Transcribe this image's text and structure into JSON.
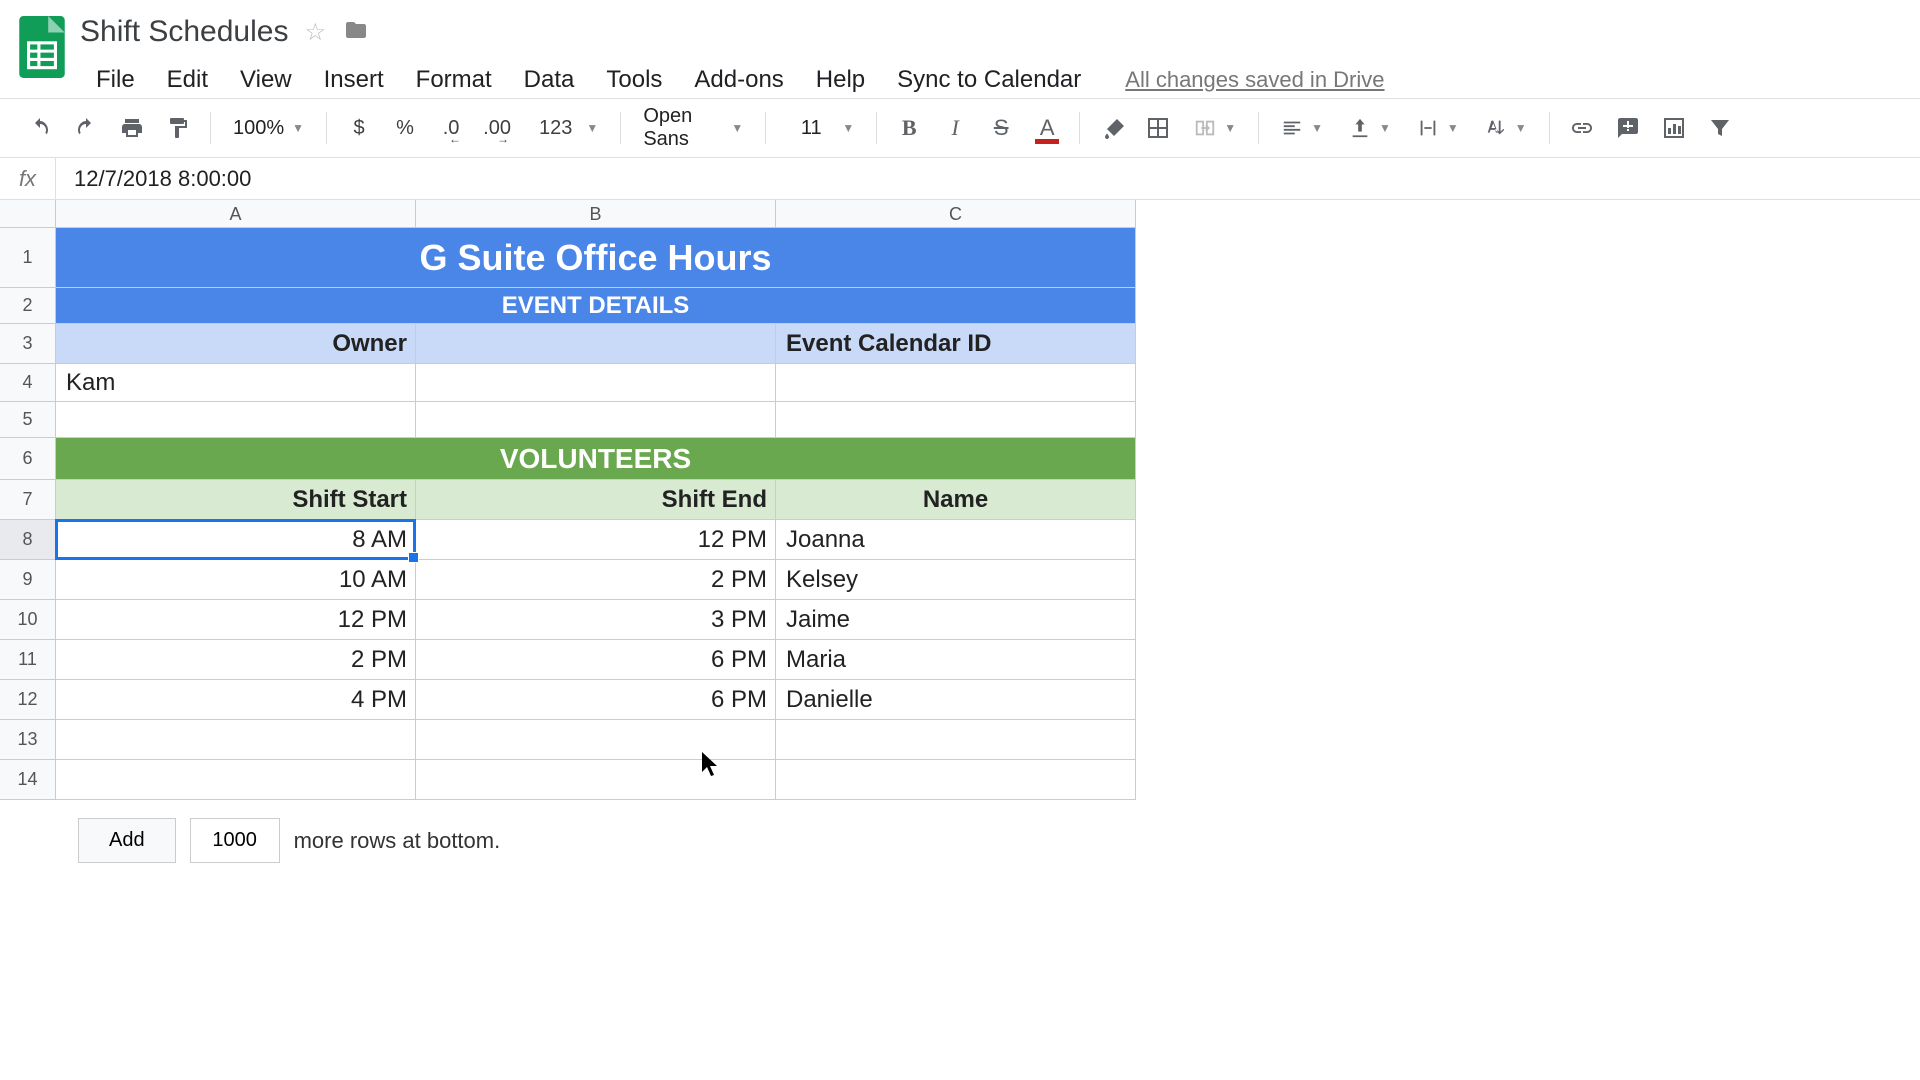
{
  "doc": {
    "title": "Shift Schedules"
  },
  "menu": {
    "file": "File",
    "edit": "Edit",
    "view": "View",
    "insert": "Insert",
    "format": "Format",
    "data": "Data",
    "tools": "Tools",
    "addons": "Add-ons",
    "help": "Help",
    "sync": "Sync to Calendar",
    "save_status": "All changes saved in Drive"
  },
  "toolbar": {
    "zoom": "100%",
    "currency": "$",
    "percent": "%",
    "dec_dec": ".0",
    "dec_inc": ".00",
    "format_num": "123",
    "font": "Open Sans",
    "font_size": "11",
    "bold": "B",
    "italic": "I",
    "strike": "S",
    "textcolor": "A"
  },
  "formula": {
    "label": "fx",
    "value": "12/7/2018 8:00:00"
  },
  "columns": {
    "A": "A",
    "B": "B",
    "C": "C"
  },
  "rows": [
    "1",
    "2",
    "3",
    "4",
    "5",
    "6",
    "7",
    "8",
    "9",
    "10",
    "11",
    "12",
    "13",
    "14"
  ],
  "sheet": {
    "title": "G Suite Office Hours",
    "subtitle": "EVENT DETAILS",
    "owner_label": "Owner",
    "calendar_label": "Event Calendar ID",
    "owner_value": "Kam",
    "vol_header": "VOLUNTEERS",
    "col_start": "Shift Start",
    "col_end": "Shift End",
    "col_name": "Name",
    "data": [
      {
        "start": "8 AM",
        "end": "12 PM",
        "name": "Joanna"
      },
      {
        "start": "10 AM",
        "end": "2 PM",
        "name": "Kelsey"
      },
      {
        "start": "12 PM",
        "end": "3 PM",
        "name": "Jaime"
      },
      {
        "start": "2 PM",
        "end": "6 PM",
        "name": "Maria"
      },
      {
        "start": "4 PM",
        "end": "6 PM",
        "name": "Danielle"
      }
    ]
  },
  "addrows": {
    "btn": "Add",
    "count": "1000",
    "text": "more rows at bottom."
  }
}
